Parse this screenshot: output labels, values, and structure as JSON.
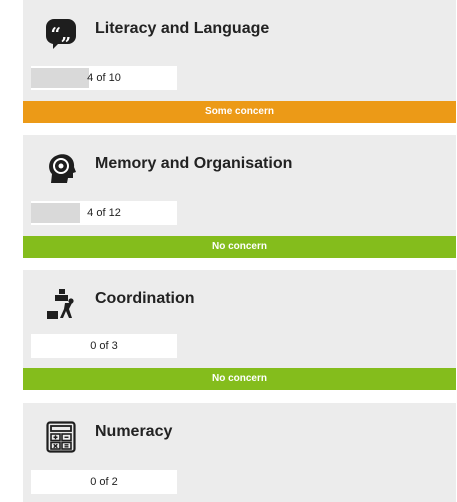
{
  "colors": {
    "some_concern": "#ec9a17",
    "no_concern": "#84bd1c",
    "card_bg": "#ececec",
    "progress_fill": "#d9d9d9"
  },
  "cards": [
    {
      "title": "Literacy and Language",
      "icon": "speech-quote-icon",
      "progress_text": "4 of 10",
      "progress_value": 0.4,
      "status": "Some concern",
      "status_type": "some_concern"
    },
    {
      "title": "Memory and Organisation",
      "icon": "brain-head-icon",
      "progress_text": "4 of 12",
      "progress_value": 0.333,
      "status": "No concern",
      "status_type": "no_concern"
    },
    {
      "title": "Coordination",
      "icon": "juggling-person-icon",
      "progress_text": "0 of 3",
      "progress_value": 0,
      "status": "No concern",
      "status_type": "no_concern"
    },
    {
      "title": "Numeracy",
      "icon": "calculator-icon",
      "progress_text": "0 of 2",
      "progress_value": 0
    }
  ]
}
